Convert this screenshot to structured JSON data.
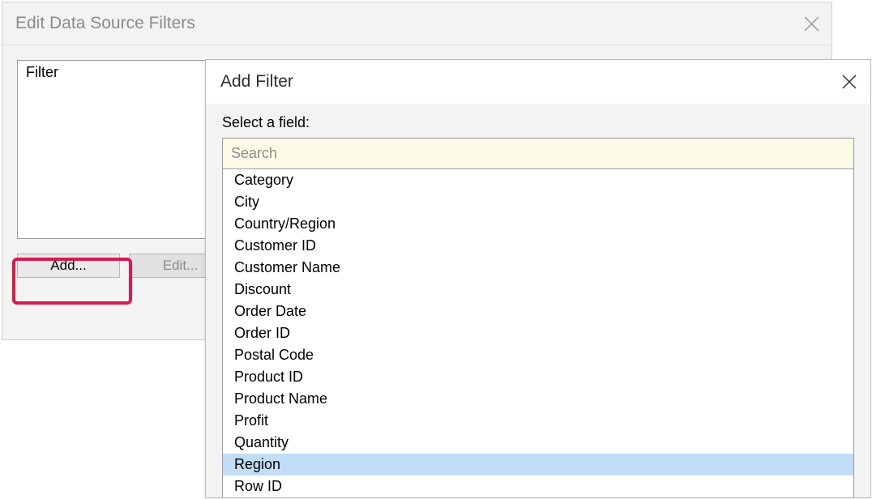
{
  "parent_dialog": {
    "title": "Edit Data Source Filters",
    "filter_header": "Filter",
    "buttons": {
      "add": "Add...",
      "edit": "Edit..."
    }
  },
  "child_dialog": {
    "title": "Add Filter",
    "select_label": "Select a field:",
    "search_placeholder": "Search",
    "fields": [
      "Category",
      "City",
      "Country/Region",
      "Customer ID",
      "Customer Name",
      "Discount",
      "Order Date",
      "Order ID",
      "Postal Code",
      "Product ID",
      "Product Name",
      "Profit",
      "Quantity",
      "Region",
      "Row ID"
    ],
    "selected_field": "Region"
  }
}
